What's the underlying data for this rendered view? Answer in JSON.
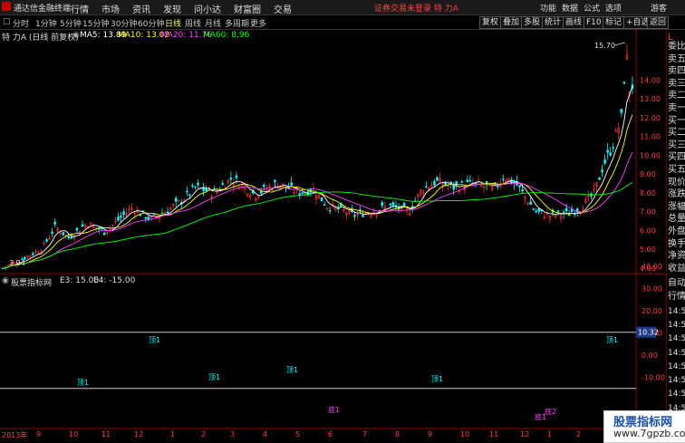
{
  "app": {
    "title": "通达信金融终端"
  },
  "menu": [
    "行情",
    "市场",
    "资讯",
    "发现",
    "问小达",
    "财富圈",
    "交易"
  ],
  "status": "证券交易未登录  特 力A",
  "right_menu": [
    "功能",
    "数据",
    "公式",
    "选项",
    "游客"
  ],
  "periods": [
    "分时",
    "1分钟",
    "5分钟",
    "15分钟",
    "30分钟",
    "60分钟",
    "日线",
    "周线",
    "月线",
    "多周期",
    "更多"
  ],
  "active_period": "日线",
  "toolbar": [
    "复权",
    "叠加",
    "多股",
    "统计",
    "画线",
    "F10",
    "标记",
    "+自选",
    "返回"
  ],
  "stock_label": "特 力A (日线 前复权)",
  "ma": [
    {
      "label": "MA5: 13.89",
      "color": "#ffffff"
    },
    {
      "label": "MA10: 13.02",
      "color": "#ffff00"
    },
    {
      "label": "MA20: 11.76",
      "color": "#ff40ff"
    },
    {
      "label": "MA60: 8.96",
      "color": "#00ff00"
    }
  ],
  "price_axis": [
    "14.00",
    "13.00",
    "12.00",
    "11.00",
    "10.00",
    "9.00",
    "8.00",
    "7.00",
    "6.00",
    "5.00",
    "4.00"
  ],
  "high_label": "15.70",
  "low_label": "3.94",
  "indicator": {
    "name": "股票指标网",
    "e3": "E3: 15.00",
    "e4": "E4: -15.00",
    "axis": [
      "40.00",
      "30.00",
      "20.00",
      "10.00",
      "0.00",
      "-10.00"
    ],
    "current": "10.32",
    "top_labels": [
      "顶1",
      "顶1",
      "顶1",
      "顶1",
      "顶1",
      "顶1"
    ],
    "bottom_labels": [
      "底1",
      "底1",
      "底2"
    ]
  },
  "sidebar": [
    "委比",
    "卖五",
    "卖四",
    "卖三",
    "卖二",
    "卖一",
    "买一",
    "买二",
    "买三",
    "买四",
    "买五",
    "现价",
    "涨跌",
    "涨幅",
    "总量",
    "外盘",
    "换手",
    "净资",
    "收益"
  ],
  "sidebar_lower": [
    "自动",
    "行情",
    "14:56",
    "14:56",
    "14:56",
    "14:56",
    "14:56",
    "14:56",
    "14:56",
    "14:56",
    "14:56"
  ],
  "sidebar_top": "L",
  "x_axis": [
    "2013年",
    "9",
    "10",
    "11",
    "12",
    "1",
    "2",
    "3",
    "4",
    "5",
    "6",
    "7",
    "8",
    "9",
    "10",
    "11",
    "12",
    "1",
    "2"
  ],
  "watermark": {
    "name": "股票指标网",
    "url": "www.7gpzb.com"
  }
}
